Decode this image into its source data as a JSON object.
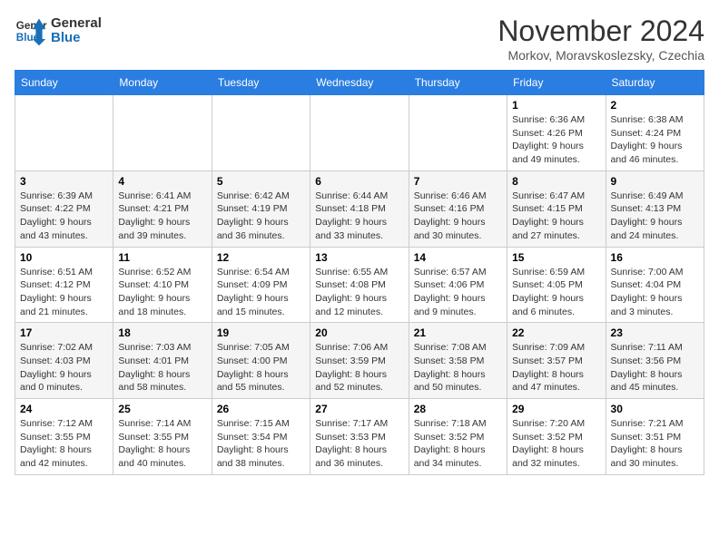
{
  "logo": {
    "line1": "General",
    "line2": "Blue"
  },
  "title": "November 2024",
  "location": "Morkov, Moravskoslezsky, Czechia",
  "days_of_week": [
    "Sunday",
    "Monday",
    "Tuesday",
    "Wednesday",
    "Thursday",
    "Friday",
    "Saturday"
  ],
  "weeks": [
    [
      {
        "day": "",
        "info": ""
      },
      {
        "day": "",
        "info": ""
      },
      {
        "day": "",
        "info": ""
      },
      {
        "day": "",
        "info": ""
      },
      {
        "day": "",
        "info": ""
      },
      {
        "day": "1",
        "info": "Sunrise: 6:36 AM\nSunset: 4:26 PM\nDaylight: 9 hours and 49 minutes."
      },
      {
        "day": "2",
        "info": "Sunrise: 6:38 AM\nSunset: 4:24 PM\nDaylight: 9 hours and 46 minutes."
      }
    ],
    [
      {
        "day": "3",
        "info": "Sunrise: 6:39 AM\nSunset: 4:22 PM\nDaylight: 9 hours and 43 minutes."
      },
      {
        "day": "4",
        "info": "Sunrise: 6:41 AM\nSunset: 4:21 PM\nDaylight: 9 hours and 39 minutes."
      },
      {
        "day": "5",
        "info": "Sunrise: 6:42 AM\nSunset: 4:19 PM\nDaylight: 9 hours and 36 minutes."
      },
      {
        "day": "6",
        "info": "Sunrise: 6:44 AM\nSunset: 4:18 PM\nDaylight: 9 hours and 33 minutes."
      },
      {
        "day": "7",
        "info": "Sunrise: 6:46 AM\nSunset: 4:16 PM\nDaylight: 9 hours and 30 minutes."
      },
      {
        "day": "8",
        "info": "Sunrise: 6:47 AM\nSunset: 4:15 PM\nDaylight: 9 hours and 27 minutes."
      },
      {
        "day": "9",
        "info": "Sunrise: 6:49 AM\nSunset: 4:13 PM\nDaylight: 9 hours and 24 minutes."
      }
    ],
    [
      {
        "day": "10",
        "info": "Sunrise: 6:51 AM\nSunset: 4:12 PM\nDaylight: 9 hours and 21 minutes."
      },
      {
        "day": "11",
        "info": "Sunrise: 6:52 AM\nSunset: 4:10 PM\nDaylight: 9 hours and 18 minutes."
      },
      {
        "day": "12",
        "info": "Sunrise: 6:54 AM\nSunset: 4:09 PM\nDaylight: 9 hours and 15 minutes."
      },
      {
        "day": "13",
        "info": "Sunrise: 6:55 AM\nSunset: 4:08 PM\nDaylight: 9 hours and 12 minutes."
      },
      {
        "day": "14",
        "info": "Sunrise: 6:57 AM\nSunset: 4:06 PM\nDaylight: 9 hours and 9 minutes."
      },
      {
        "day": "15",
        "info": "Sunrise: 6:59 AM\nSunset: 4:05 PM\nDaylight: 9 hours and 6 minutes."
      },
      {
        "day": "16",
        "info": "Sunrise: 7:00 AM\nSunset: 4:04 PM\nDaylight: 9 hours and 3 minutes."
      }
    ],
    [
      {
        "day": "17",
        "info": "Sunrise: 7:02 AM\nSunset: 4:03 PM\nDaylight: 9 hours and 0 minutes."
      },
      {
        "day": "18",
        "info": "Sunrise: 7:03 AM\nSunset: 4:01 PM\nDaylight: 8 hours and 58 minutes."
      },
      {
        "day": "19",
        "info": "Sunrise: 7:05 AM\nSunset: 4:00 PM\nDaylight: 8 hours and 55 minutes."
      },
      {
        "day": "20",
        "info": "Sunrise: 7:06 AM\nSunset: 3:59 PM\nDaylight: 8 hours and 52 minutes."
      },
      {
        "day": "21",
        "info": "Sunrise: 7:08 AM\nSunset: 3:58 PM\nDaylight: 8 hours and 50 minutes."
      },
      {
        "day": "22",
        "info": "Sunrise: 7:09 AM\nSunset: 3:57 PM\nDaylight: 8 hours and 47 minutes."
      },
      {
        "day": "23",
        "info": "Sunrise: 7:11 AM\nSunset: 3:56 PM\nDaylight: 8 hours and 45 minutes."
      }
    ],
    [
      {
        "day": "24",
        "info": "Sunrise: 7:12 AM\nSunset: 3:55 PM\nDaylight: 8 hours and 42 minutes."
      },
      {
        "day": "25",
        "info": "Sunrise: 7:14 AM\nSunset: 3:55 PM\nDaylight: 8 hours and 40 minutes."
      },
      {
        "day": "26",
        "info": "Sunrise: 7:15 AM\nSunset: 3:54 PM\nDaylight: 8 hours and 38 minutes."
      },
      {
        "day": "27",
        "info": "Sunrise: 7:17 AM\nSunset: 3:53 PM\nDaylight: 8 hours and 36 minutes."
      },
      {
        "day": "28",
        "info": "Sunrise: 7:18 AM\nSunset: 3:52 PM\nDaylight: 8 hours and 34 minutes."
      },
      {
        "day": "29",
        "info": "Sunrise: 7:20 AM\nSunset: 3:52 PM\nDaylight: 8 hours and 32 minutes."
      },
      {
        "day": "30",
        "info": "Sunrise: 7:21 AM\nSunset: 3:51 PM\nDaylight: 8 hours and 30 minutes."
      }
    ]
  ]
}
